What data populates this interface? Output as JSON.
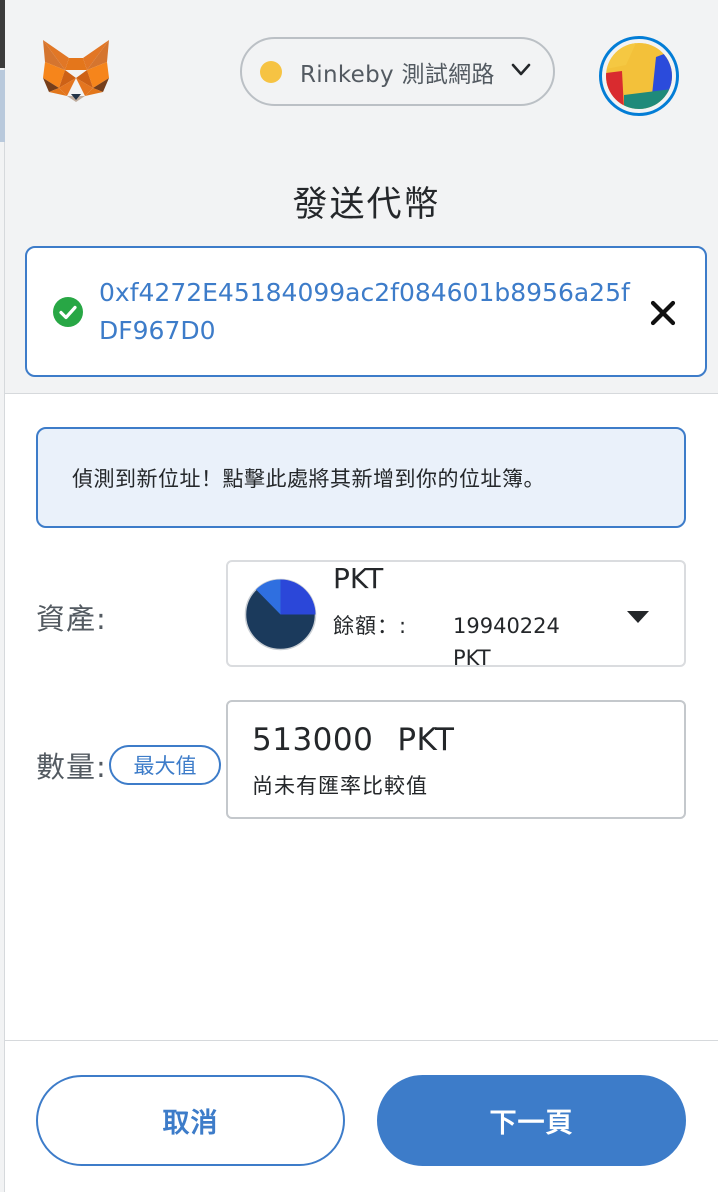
{
  "header": {
    "logo_icon": "metamask-fox-icon",
    "network": {
      "label": "Rinkeby 測試網路",
      "dot_color": "#f6c343",
      "icon": "chevron-down-icon"
    },
    "account_icon": "account-avatar-identicon"
  },
  "page": {
    "title": "發送代幣"
  },
  "recipient": {
    "address": "0xf4272E45184099ac2f084601b8956a25fDF967D0",
    "status_icon": "check-circle-icon",
    "clear_icon": "close-icon"
  },
  "notice": {
    "text": "偵測到新位址！點擊此處將其新增到你的位址簿。"
  },
  "asset": {
    "label": "資產:",
    "symbol": "PKT",
    "balance_label": "餘額：:",
    "balance_value": "19940224 PKT",
    "icon": "caret-down-icon"
  },
  "amount": {
    "label": "數量:",
    "max_button": "最大值",
    "value": "513000",
    "unit": "PKT",
    "fiat_note": "尚未有匯率比較值"
  },
  "footer": {
    "cancel_label": "取消",
    "next_label": "下一頁"
  },
  "colors": {
    "accent": "#3d7cc9",
    "success": "#28a745",
    "notice_bg": "#eaf1fa"
  }
}
